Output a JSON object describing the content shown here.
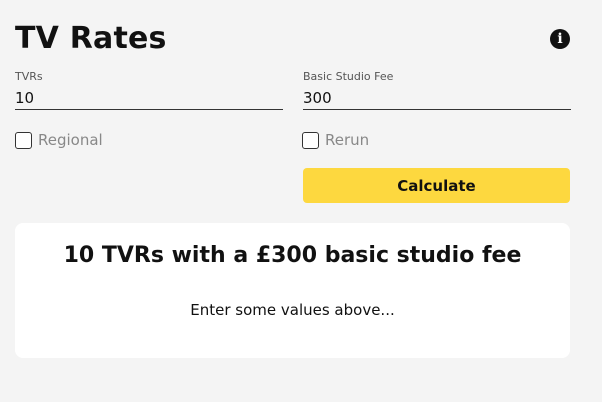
{
  "header": {
    "title": "TV Rates",
    "info_icon": "info-icon"
  },
  "form": {
    "tvrs": {
      "label": "TVRs",
      "value": "10"
    },
    "basic_studio_fee": {
      "label": "Basic Studio Fee",
      "value": "300"
    },
    "regional": {
      "label": "Regional",
      "checked": false
    },
    "rerun": {
      "label": "Rerun",
      "checked": false
    },
    "calculate_label": "Calculate"
  },
  "result": {
    "heading": "10 TVRs with a £300 basic studio fee",
    "message": "Enter some values above..."
  },
  "colors": {
    "background": "#f4f4f4",
    "accent": "#fdd83f",
    "card": "#ffffff"
  }
}
